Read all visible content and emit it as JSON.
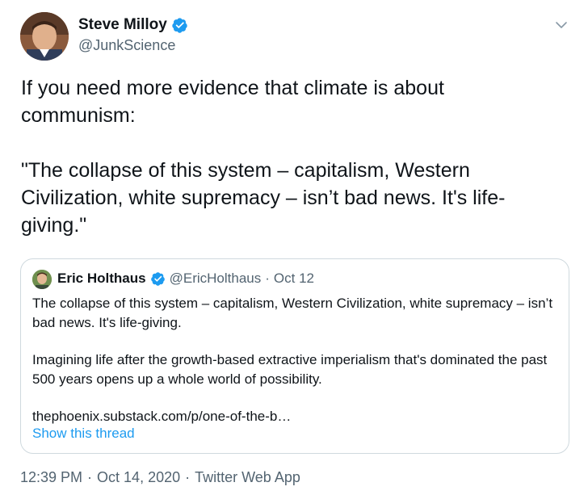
{
  "author": {
    "display_name": "Steve Milloy",
    "handle": "@JunkScience",
    "verified": true
  },
  "tweet": {
    "text": "If you need more evidence that climate is about communism:\n\n\"The collapse of this system – capitalism, Western Civilization, white supremacy – isn’t bad news. It's life-giving.\""
  },
  "quoted_tweet": {
    "display_name": "Eric Holthaus",
    "handle": "@EricHolthaus",
    "separator": "·",
    "date": "Oct 12",
    "verified": true,
    "paragraph_1": "The collapse of this system – capitalism, Western Civilization, white supremacy – isn’t bad news. It's life-giving.",
    "paragraph_2": "Imagining life after the growth-based extractive imperialism that's dominated the past 500 years opens up a whole world of possibility.",
    "link": "thephoenix.substack.com/p/one-of-the-b…",
    "show_thread": "Show this thread"
  },
  "meta": {
    "time": "12:39 PM",
    "separator": "·",
    "date": "Oct 14, 2020",
    "source": "Twitter Web App"
  },
  "colors": {
    "text_primary": "#0f1419",
    "text_secondary": "#536471",
    "accent": "#1d9bf0",
    "border": "#cfd9de"
  },
  "icons": {
    "verified": "verified-badge-icon",
    "caret": "chevron-down-icon"
  }
}
